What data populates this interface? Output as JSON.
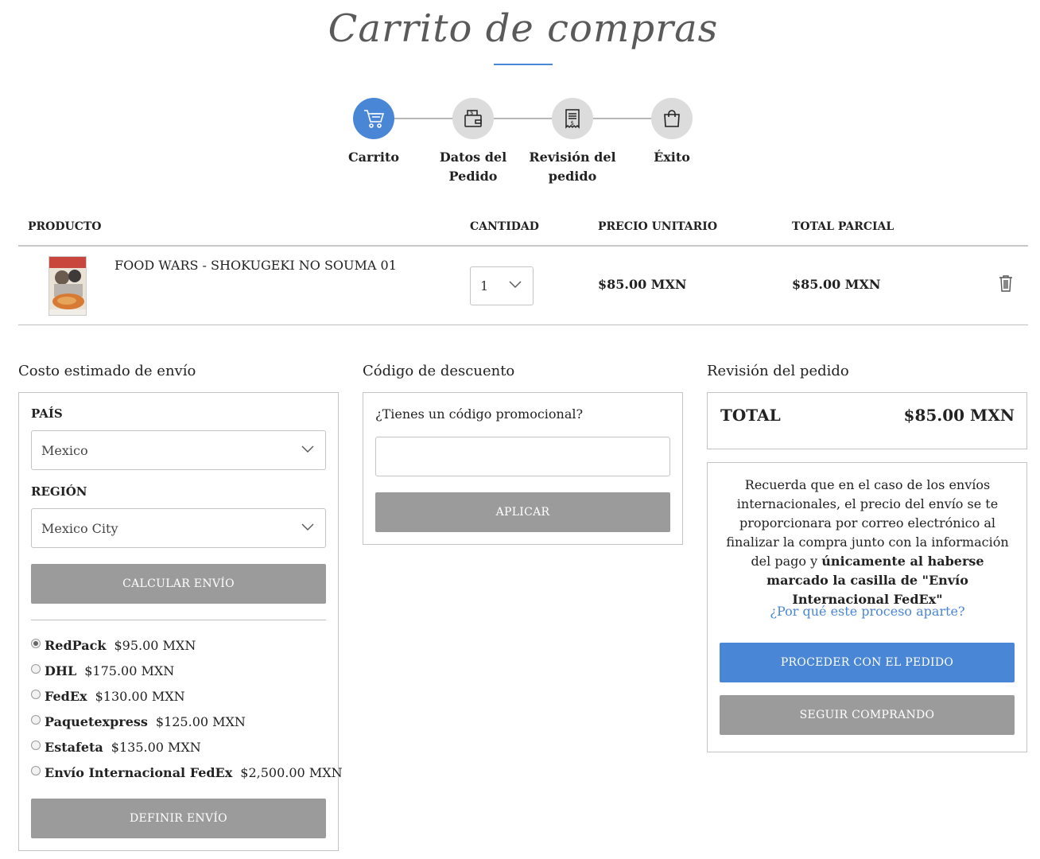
{
  "page": {
    "title": "Carrito de compras"
  },
  "steps": [
    {
      "label": "Carrito",
      "icon": "shopping-cart-icon",
      "active": true
    },
    {
      "label": "Datos del Pedido",
      "icon": "wallet-icon",
      "active": false
    },
    {
      "label": "Revisión del pedido",
      "icon": "receipt-icon",
      "active": false
    },
    {
      "label": "Éxito",
      "icon": "shopping-bag-icon",
      "active": false
    }
  ],
  "table": {
    "headers": [
      "PRODUCTO",
      "CANTIDAD",
      "PRECIO UNITARIO",
      "TOTAL PARCIAL"
    ],
    "rows": [
      {
        "name": "FOOD WARS - SHOKUGEKI NO SOUMA 01",
        "quantity": "1",
        "unit_price": "$85.00 MXN",
        "subtotal": "$85.00 MXN"
      }
    ]
  },
  "shipping": {
    "title": "Costo estimado de envío",
    "country_label": "PAÍS",
    "country_value": "Mexico",
    "region_label": "REGIÓN",
    "region_value": "Mexico City",
    "calc_button": "CALCULAR ENVÍO",
    "options": [
      {
        "carrier": "RedPack",
        "price": "$95.00 MXN",
        "selected": true
      },
      {
        "carrier": "DHL",
        "price": "$175.00 MXN",
        "selected": false
      },
      {
        "carrier": "FedEx",
        "price": "$130.00 MXN",
        "selected": false
      },
      {
        "carrier": "Paquetexpress",
        "price": "$125.00 MXN",
        "selected": false
      },
      {
        "carrier": "Estafeta",
        "price": "$135.00 MXN",
        "selected": false
      },
      {
        "carrier": "Envío Internacional FedEx",
        "price": "$2,500.00 MXN",
        "selected": false
      }
    ],
    "define_button": "DEFINIR ENVÍO"
  },
  "discount": {
    "title": "Código de descuento",
    "question": "¿Tienes un código promocional?",
    "input_value": "",
    "apply_button": "APLICAR"
  },
  "review": {
    "title": "Revisión del pedido",
    "total_label": "TOTAL",
    "total_value": "$85.00 MXN",
    "note_part1": "Recuerda que en el caso de los envíos internacionales, el precio del envío se te proporcionara por correo electrónico al finalizar la compra junto con la información del pago y ",
    "note_bold": "únicamente al haberse marcado la casilla de \"Envío Internacional FedEx\"",
    "link": "¿Por qué este proceso aparte?",
    "proceed_button": "PROCEDER CON EL PEDIDO",
    "continue_button": "SEGUIR COMPRANDO"
  },
  "colors": {
    "accent": "#4a86d6",
    "button_grey": "#9b9b9b",
    "step_grey": "#dcdcdc"
  }
}
